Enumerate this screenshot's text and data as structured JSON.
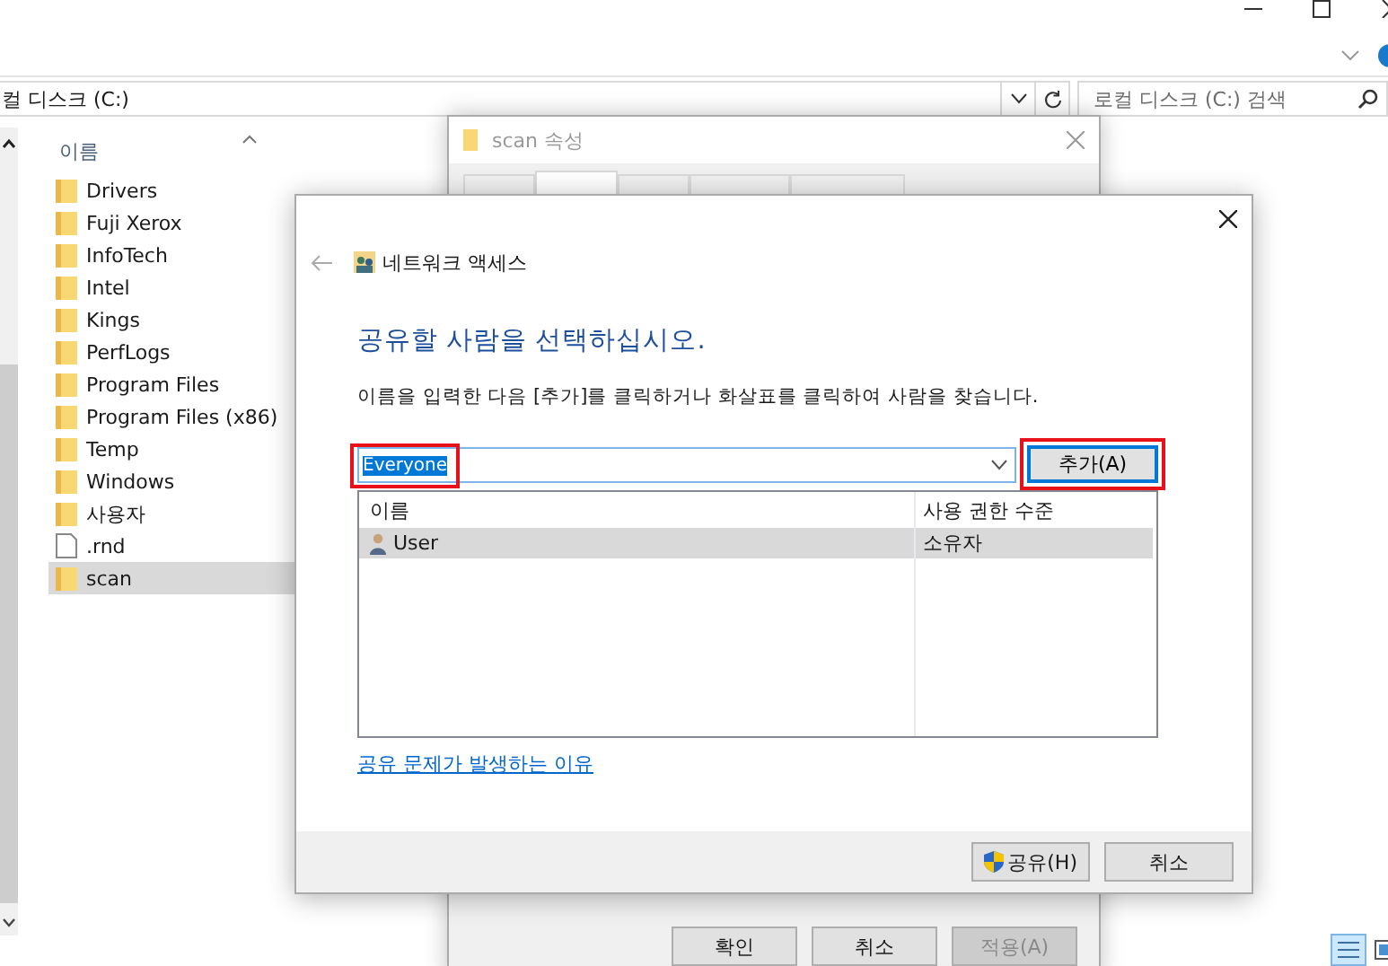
{
  "explorer": {
    "address": "컬 디스크 (C:)",
    "search": {
      "placeholder": "로컬 디스크 (C:) 검색"
    },
    "column_header": "이름",
    "items": [
      {
        "name": "Drivers",
        "kind": "folder",
        "selected": false
      },
      {
        "name": "Fuji Xerox",
        "kind": "folder",
        "selected": false
      },
      {
        "name": "InfoTech",
        "kind": "folder",
        "selected": false
      },
      {
        "name": "Intel",
        "kind": "folder",
        "selected": false
      },
      {
        "name": "Kings",
        "kind": "folder",
        "selected": false
      },
      {
        "name": "PerfLogs",
        "kind": "folder",
        "selected": false
      },
      {
        "name": "Program Files",
        "kind": "folder",
        "selected": false
      },
      {
        "name": "Program Files (x86)",
        "kind": "folder",
        "selected": false
      },
      {
        "name": "Temp",
        "kind": "folder",
        "selected": false
      },
      {
        "name": "Windows",
        "kind": "folder",
        "selected": false
      },
      {
        "name": "사용자",
        "kind": "folder",
        "selected": false
      },
      {
        "name": ".rnd",
        "kind": "file",
        "selected": false
      },
      {
        "name": "scan",
        "kind": "folder",
        "selected": true
      }
    ]
  },
  "properties_dialog": {
    "title": "scan 속성",
    "tabs": [
      {
        "selected": false
      },
      {
        "selected": true
      },
      {
        "selected": false
      },
      {
        "selected": false
      },
      {
        "selected": false
      }
    ],
    "buttons": [
      {
        "label": "확인",
        "disabled": false
      },
      {
        "label": "취소",
        "disabled": false
      },
      {
        "label": "적용(A)",
        "disabled": true
      }
    ]
  },
  "network_dialog": {
    "title": "네트워크 액세스",
    "heading": "공유할 사람을 선택하십시오.",
    "instruction": "이름을 입력한 다음 [추가]를 클릭하거나 화살표를 클릭하여 사람을 찾습니다.",
    "name_input": {
      "value": "Everyone"
    },
    "add_button": "추가(A)",
    "table": {
      "columns": [
        "이름",
        "사용 권한 수준"
      ],
      "rows": [
        {
          "name": "User",
          "permission": "소유자",
          "selected": true
        }
      ]
    },
    "help_link": "공유 문제가 발생하는 이유",
    "buttons": [
      {
        "label": "공유(H)",
        "kind": "shield"
      },
      {
        "label": "취소",
        "kind": "plain"
      }
    ]
  }
}
